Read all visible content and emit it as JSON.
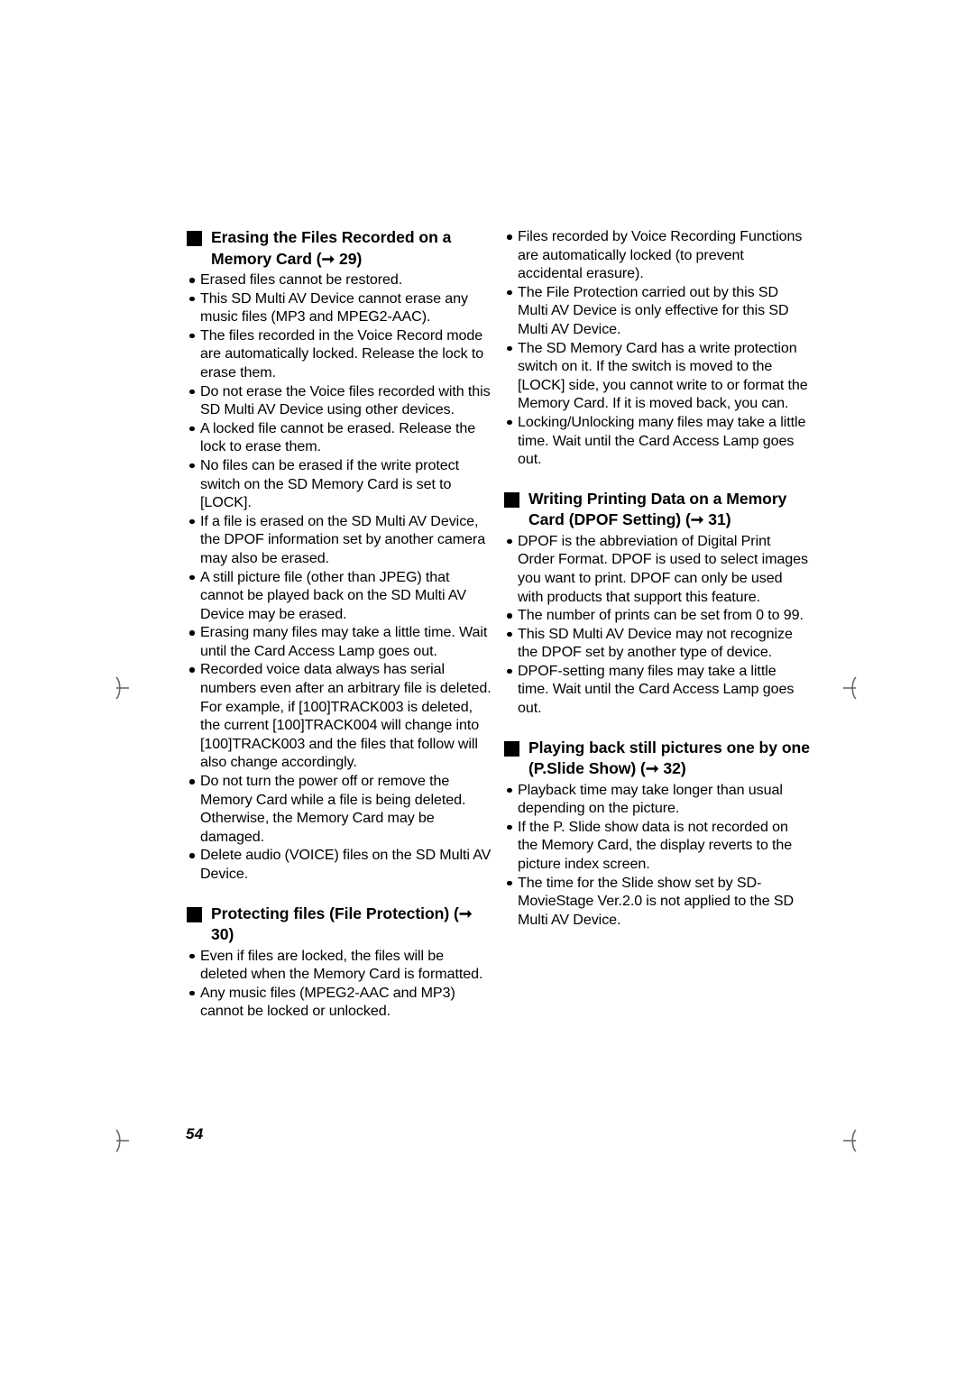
{
  "page": {
    "number": "54"
  },
  "columns": {
    "left": [
      {
        "type": "heading",
        "name": "heading-erasing-files",
        "text": "Erasing the Files Recorded on a Memory Card (➞ 29)"
      },
      {
        "type": "list",
        "name": "list-erasing-files",
        "items": [
          "Erased files cannot be restored.",
          "This SD Multi AV Device cannot erase any music files (MP3 and MPEG2-AAC).",
          "The files recorded in the Voice Record mode are automatically locked. Release the lock to erase them.",
          "Do not erase the Voice files recorded with this SD Multi AV Device using other devices.",
          "A locked file cannot be erased. Release the lock to erase them.",
          "No files can be erased if the write protect switch on the SD Memory Card is set to [LOCK].",
          "If a file is erased on the SD Multi AV Device, the DPOF information set by another camera may also be erased.",
          "A still picture file (other than JPEG) that cannot be played back on the SD Multi AV Device may be erased.",
          "Erasing many files may take a little time. Wait until the Card Access Lamp goes out.",
          "Recorded voice data always has serial numbers even after an arbitrary file is deleted. For example, if [100]TRACK003 is deleted, the current [100]TRACK004 will change into [100]TRACK003 and the files that follow will also change accordingly.",
          "Do not turn the power off or remove the Memory Card while a file is being deleted. Otherwise, the Memory Card may be damaged.",
          "Delete audio (VOICE) files on the SD Multi AV Device."
        ]
      },
      {
        "type": "heading",
        "name": "heading-protecting-files",
        "text": "Protecting files (File Protection) (➞ 30)"
      },
      {
        "type": "list",
        "name": "list-protecting-files",
        "items": [
          "Even if files are locked, the files will be deleted when the Memory Card is formatted.",
          "Any music files (MPEG2-AAC and MP3) cannot be locked or unlocked."
        ]
      }
    ],
    "right": [
      {
        "type": "list",
        "name": "list-protecting-files-continued",
        "items": [
          "Files recorded by Voice Recording Functions are automatically locked (to prevent accidental erasure).",
          "The File Protection carried out by this SD Multi AV Device is only effective for this SD Multi AV Device.",
          "The SD Memory Card has a write protection switch on it. If the switch is moved to the [LOCK] side, you cannot write to or format the Memory Card. If it is moved back, you can.",
          "Locking/Unlocking many files may take a little time. Wait until the Card Access Lamp goes out."
        ]
      },
      {
        "type": "heading",
        "name": "heading-writing-printing-data",
        "text": "Writing Printing Data on a Memory Card (DPOF Setting) (➞ 31)"
      },
      {
        "type": "list",
        "name": "list-writing-printing-data",
        "items": [
          "DPOF is the abbreviation of Digital Print Order Format. DPOF is used to select images you want to print. DPOF can only be used with products that support this feature.",
          "The number of prints can be set from 0 to 99.",
          "This SD Multi AV Device may not recognize the DPOF set by another type of device.",
          "DPOF-setting many files may take a little time. Wait until the Card Access Lamp goes out."
        ]
      },
      {
        "type": "heading",
        "name": "heading-playing-back-still-pictures",
        "text": "Playing back still pictures one by one (P.Slide Show) (➞ 32)"
      },
      {
        "type": "list",
        "name": "list-playing-back-still-pictures",
        "items": [
          "Playback time may take longer than usual depending on the picture.",
          "If the P. Slide show data is not recorded on the Memory Card, the display reverts to the picture index screen.",
          "The time for the Slide show set by SD-MovieStage Ver.2.0 is not applied to the SD Multi AV Device.",
          ""
        ]
      }
    ]
  },
  "marks": {
    "registration_top_left": "registration-mark",
    "registration_top_right": "registration-mark",
    "registration_bottom_left": "registration-mark",
    "registration_bottom_right": "registration-mark"
  }
}
